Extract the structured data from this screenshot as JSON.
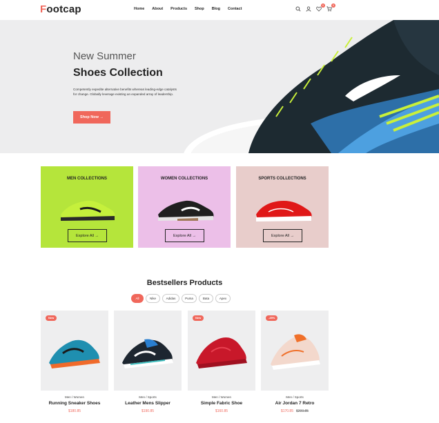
{
  "header": {
    "logo_first": "F",
    "logo_rest": "ootcap",
    "nav": [
      "Home",
      "About",
      "Products",
      "Shop",
      "Blog",
      "Contact"
    ],
    "icons": [
      "search-icon",
      "user-icon",
      "heart-icon",
      "cart-icon"
    ],
    "wishlist_count": "0",
    "cart_count": "0"
  },
  "hero": {
    "subtitle": "New Summer",
    "title": "Shoes Collection",
    "description": "Competently expedite alternative benefits whereas leading-edge catalysts for change. Globally leverage existing an expanded array of leadership.",
    "button": "Shop Now →"
  },
  "collections": [
    {
      "title": "MEN COLLECTIONS",
      "button": "Explore All →",
      "bg": "#b5e53b"
    },
    {
      "title": "WOMEN COLLECTIONS",
      "button": "Explore All →",
      "bg": "#ecbfe8"
    },
    {
      "title": "SPORTS COLLECTIONS",
      "button": "Explore All →",
      "bg": "#e8cdcb"
    }
  ],
  "bestsellers": {
    "title": "Bestsellers Products",
    "filters": [
      "All",
      "Nike",
      "Adidas",
      "Puma",
      "Bata",
      "Apex"
    ],
    "products": [
      {
        "badge": "New",
        "category": "Men / Women",
        "name": "Running Sneaker Shoes",
        "price": "$180.85",
        "old_price": ""
      },
      {
        "badge": "",
        "category": "Men / Sports",
        "name": "Leather Mens Slipper",
        "price": "$190.85",
        "old_price": ""
      },
      {
        "badge": "New",
        "category": "Men / Women",
        "name": "Simple Fabric Shoe",
        "price": "$160.85",
        "old_price": ""
      },
      {
        "badge": "-25%",
        "category": "Men / Sports",
        "name": "Air Jordan 7 Retro",
        "price": "$170.85",
        "old_price": "$200.85"
      }
    ]
  },
  "colors": {
    "accent": "#f0675b"
  }
}
